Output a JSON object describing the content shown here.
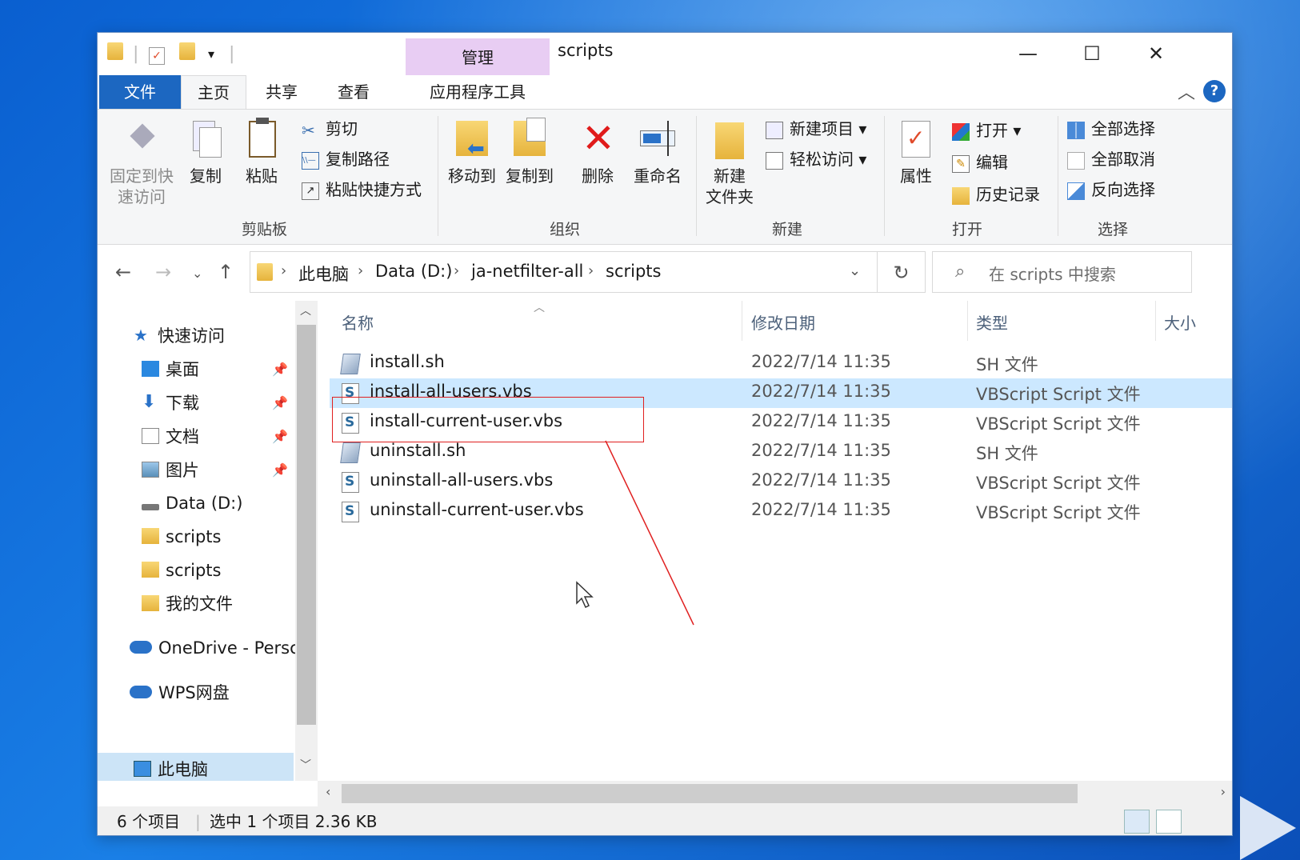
{
  "window": {
    "title": "scripts",
    "context_tab": "管理",
    "controls": {
      "minimize": "—",
      "maximize": "☐",
      "close": "✕"
    }
  },
  "ribbon_tabs": {
    "file": "文件",
    "home": "主页",
    "share": "共享",
    "view": "查看",
    "app_tools": "应用程序工具"
  },
  "ribbon": {
    "clipboard": {
      "pin_quick": [
        "固定到快",
        "速访问"
      ],
      "copy": "复制",
      "paste": "粘贴",
      "cut": "剪切",
      "copy_path": "复制路径",
      "paste_shortcut": "粘贴快捷方式",
      "label": "剪贴板"
    },
    "organize": {
      "move_to": "移动到",
      "copy_to": "复制到",
      "delete": "删除",
      "rename": "重命名",
      "label": "组织"
    },
    "new": {
      "new_folder": [
        "新建",
        "文件夹"
      ],
      "new_item": "新建项目",
      "easy_access": "轻松访问",
      "label": "新建"
    },
    "open": {
      "properties": "属性",
      "open": "打开",
      "edit": "编辑",
      "history": "历史记录",
      "label": "打开"
    },
    "select": {
      "select_all": "全部选择",
      "select_none": "全部取消",
      "invert": "反向选择",
      "label": "选择"
    }
  },
  "address": {
    "crumbs": [
      "此电脑",
      "Data (D:)",
      "ja-netfilter-all",
      "scripts"
    ],
    "search_placeholder": "在 scripts 中搜索"
  },
  "nav": {
    "quick_access": "快速访问",
    "items": [
      {
        "label": "桌面",
        "pinned": true
      },
      {
        "label": "下载",
        "pinned": true
      },
      {
        "label": "文档",
        "pinned": true
      },
      {
        "label": "图片",
        "pinned": true
      },
      {
        "label": "Data (D:)",
        "pinned": false
      },
      {
        "label": "scripts",
        "pinned": false
      },
      {
        "label": "scripts",
        "pinned": false
      },
      {
        "label": "我的文件",
        "pinned": false
      }
    ],
    "onedrive": "OneDrive - Persc",
    "wps": "WPS网盘",
    "this_pc": "此电脑"
  },
  "columns": {
    "name": "名称",
    "modified": "修改日期",
    "type": "类型",
    "size": "大小"
  },
  "files": [
    {
      "name": "install.sh",
      "date": "2022/7/14 11:35",
      "type": "SH 文件",
      "kind": "sh"
    },
    {
      "name": "install-all-users.vbs",
      "date": "2022/7/14 11:35",
      "type": "VBScript Script 文件",
      "kind": "vbs"
    },
    {
      "name": "install-current-user.vbs",
      "date": "2022/7/14 11:35",
      "type": "VBScript Script 文件",
      "kind": "vbs"
    },
    {
      "name": "uninstall.sh",
      "date": "2022/7/14 11:35",
      "type": "SH 文件",
      "kind": "sh"
    },
    {
      "name": "uninstall-all-users.vbs",
      "date": "2022/7/14 11:35",
      "type": "VBScript Script 文件",
      "kind": "vbs"
    },
    {
      "name": "uninstall-current-user.vbs",
      "date": "2022/7/14 11:35",
      "type": "VBScript Script 文件",
      "kind": "vbs"
    }
  ],
  "selected_index": 1,
  "status": {
    "count": "6 个项目",
    "selection": "选中 1 个项目  2.36 KB"
  },
  "colors": {
    "accent": "#1c67c1",
    "selection": "#cce8ff",
    "annotation": "#e02020"
  }
}
